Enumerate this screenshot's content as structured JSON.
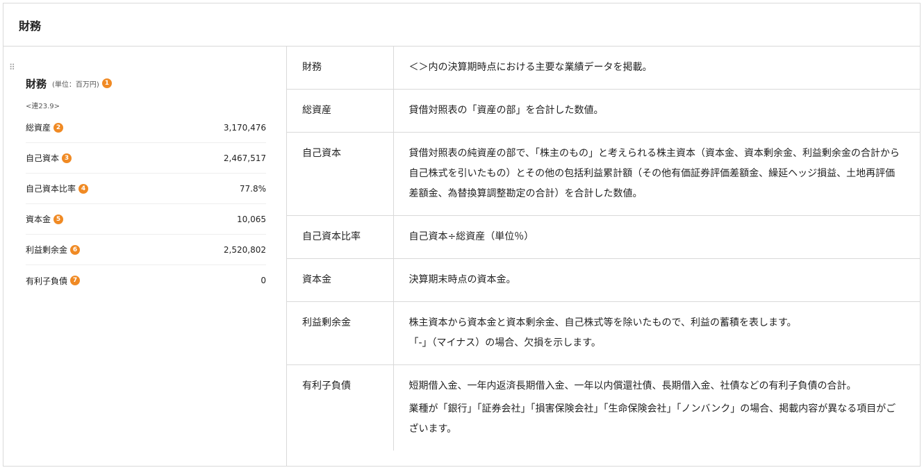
{
  "header": {
    "title": "財務"
  },
  "summary": {
    "drag_handle": "⠿",
    "title": "財務",
    "unit": "(単位：百万円)",
    "title_badge": "1",
    "period": "<連23.9>",
    "rows": [
      {
        "label": "総資産",
        "badge": "2",
        "value": "3,170,476"
      },
      {
        "label": "自己資本",
        "badge": "3",
        "value": "2,467,517"
      },
      {
        "label": "自己資本比率",
        "badge": "4",
        "value": "77.8%"
      },
      {
        "label": "資本金",
        "badge": "5",
        "value": "10,065"
      },
      {
        "label": "利益剰余金",
        "badge": "6",
        "value": "2,520,802"
      },
      {
        "label": "有利子負債",
        "badge": "7",
        "value": "0"
      }
    ]
  },
  "glossary": [
    {
      "term": "財務",
      "desc": [
        "＜＞内の決算期時点における主要な業績データを掲載。"
      ]
    },
    {
      "term": "総資産",
      "desc": [
        "貸借対照表の「資産の部」を合計した数値。"
      ]
    },
    {
      "term": "自己資本",
      "desc": [
        "貸借対照表の純資産の部で、「株主のもの」と考えられる株主資本（資本金、資本剰余金、利益剰余金の合計から自己株式を引いたもの）とその他の包括利益累計額（その他有価証券評価差額金、繰延ヘッジ損益、土地再評価差額金、為替換算調整勘定の合計）を合計した数値。"
      ]
    },
    {
      "term": "自己資本比率",
      "desc": [
        "自己資本÷総資産（単位％）"
      ]
    },
    {
      "term": "資本金",
      "desc": [
        "決算期末時点の資本金。"
      ]
    },
    {
      "term": "利益剰余金",
      "desc": [
        "株主資本から資本金と資本剰余金、自己株式等を除いたもので、利益の蓄積を表します。\n「-」（マイナス）の場合、欠損を示します。"
      ]
    },
    {
      "term": "有利子負債",
      "desc": [
        "短期借入金、一年内返済長期借入金、一年以内償還社債、長期借入金、社債などの有利子負債の合計。",
        "業種が「銀行」「証券会社」「損害保険会社」「生命保険会社」「ノンバンク」の場合、掲載内容が異なる項目がございます。"
      ]
    }
  ],
  "colors": {
    "accent_badge": "#f08a24",
    "border": "#d9d9d9"
  }
}
